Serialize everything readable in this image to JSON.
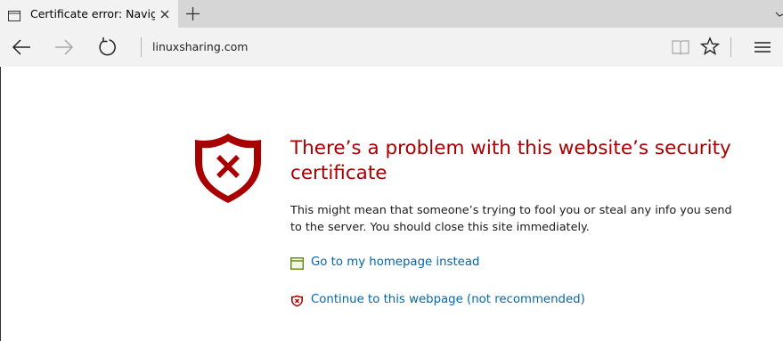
{
  "tab": {
    "title": "Certificate error: Naviga"
  },
  "address_bar": {
    "url": "linuxsharing.com"
  },
  "icons": {
    "tab": "page-icon",
    "close": "close-icon",
    "new_tab": "plus-icon",
    "back": "arrow-left-icon",
    "forward": "arrow-right-icon",
    "refresh": "refresh-icon",
    "reading_view": "book-icon",
    "favorite": "star-icon",
    "hub": "hamburger-menu-icon",
    "error": "shield-x-icon",
    "homepage": "window-icon",
    "continue": "shield-x-small-icon"
  },
  "colors": {
    "error_red": "#a80000",
    "link_blue": "#0066b4",
    "chrome_gray": "#f2f2f2",
    "tabstrip_gray": "#d6d6d6"
  },
  "error": {
    "title": "There’s a problem with this website’s security certificate",
    "body": "This might mean that someone’s trying to fool you or steal any info you send to the server. You should close this site immediately.",
    "homepage_link": "Go to my homepage instead",
    "continue_link": "Continue to this webpage (not recommended)"
  }
}
